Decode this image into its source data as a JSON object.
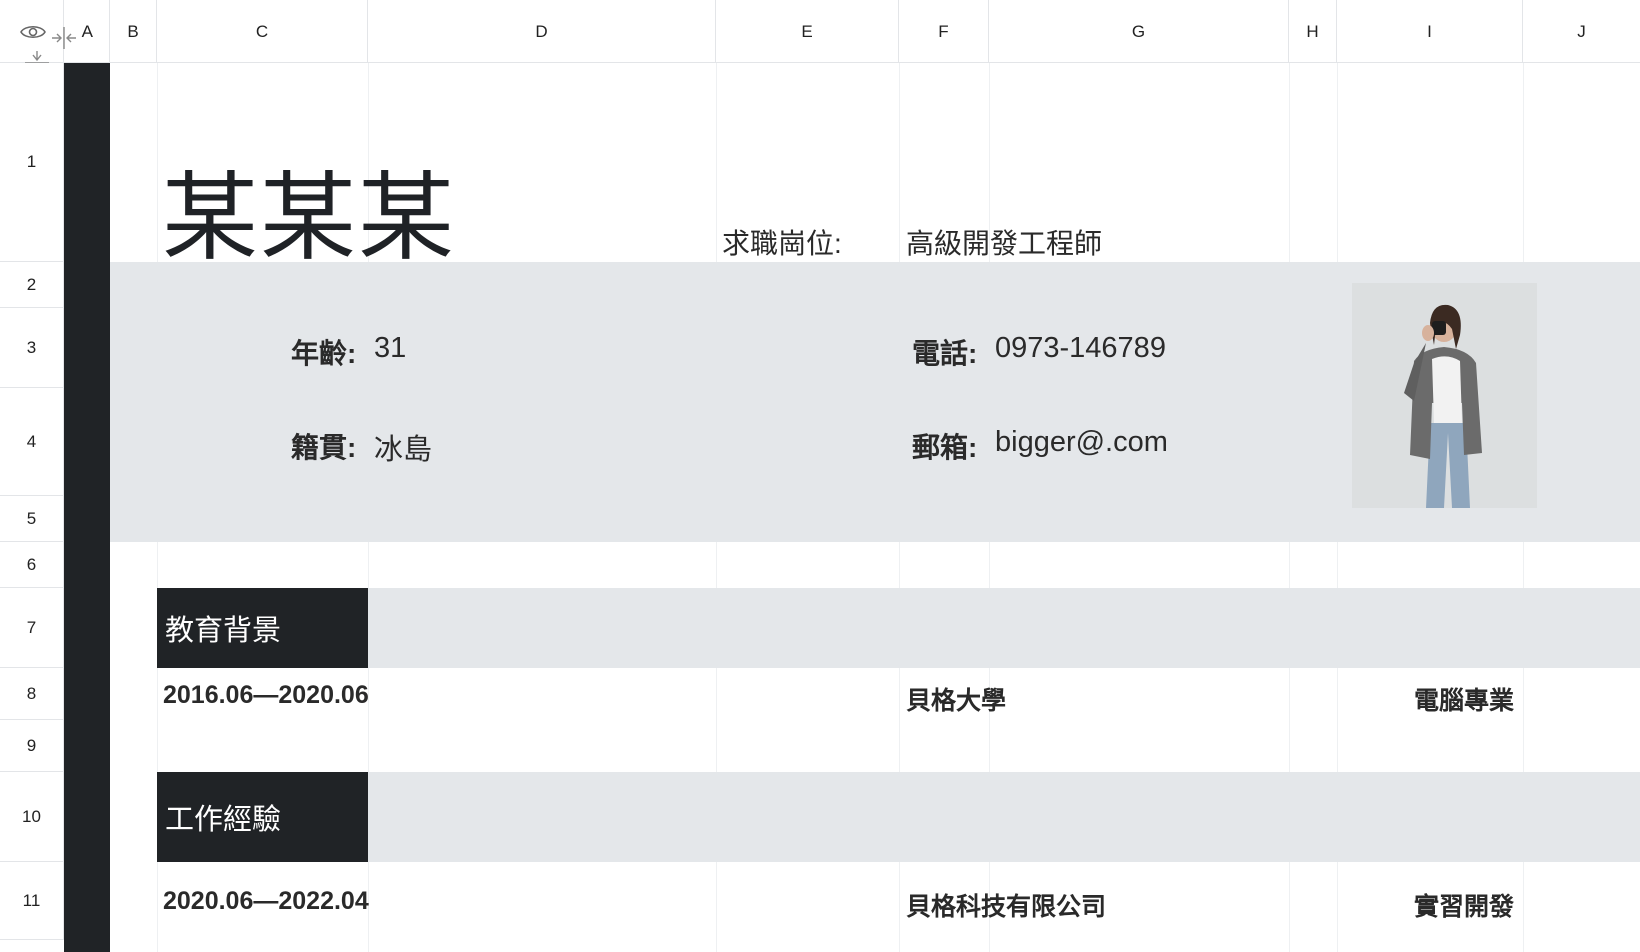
{
  "columns": [
    "A",
    "B",
    "C",
    "D",
    "E",
    "F",
    "G",
    "H",
    "I",
    "J"
  ],
  "rows": [
    "1",
    "2",
    "3",
    "4",
    "5",
    "6",
    "7",
    "8",
    "9",
    "10",
    "11"
  ],
  "icons": {
    "eye": "eye-icon",
    "collapse_cols": "collapse-columns-icon",
    "collapse_rows": "collapse-rows-icon"
  },
  "resume": {
    "name": "某某某",
    "position_label": "求職崗位:",
    "position_value": "高級開發工程師",
    "age_label": "年齡:",
    "age_value": "31",
    "origin_label": "籍貫:",
    "origin_value": "冰島",
    "phone_label": "電話:",
    "phone_value": "0973-146789",
    "email_label": "郵箱:",
    "email_value": "bigger@.com"
  },
  "education": {
    "title": "教育背景",
    "period": "2016.06—2020.06",
    "school": "貝格大學",
    "major": "電腦專業"
  },
  "work": {
    "title": "工作經驗",
    "period": "2020.06—2022.04",
    "company": "貝格科技有限公司",
    "role": "實習開發"
  },
  "colors": {
    "dark": "#202326",
    "band": "#e4e7ea"
  }
}
